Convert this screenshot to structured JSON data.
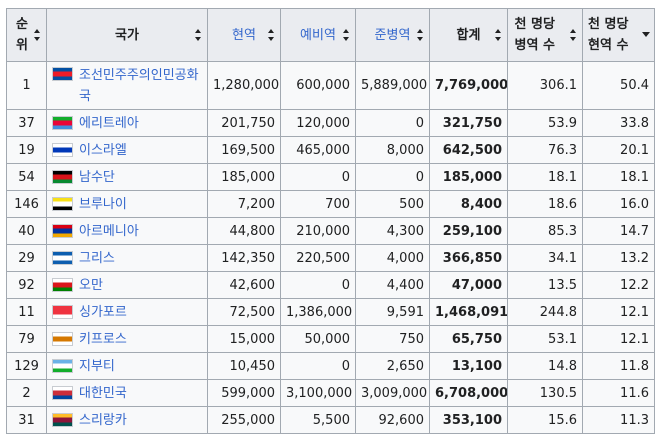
{
  "headers": [
    {
      "label": "순위",
      "link": false,
      "sort": "both"
    },
    {
      "label": "국가",
      "link": false,
      "sort": "both"
    },
    {
      "label": "현역",
      "link": true,
      "sort": "both"
    },
    {
      "label": "예비역",
      "link": true,
      "sort": "both"
    },
    {
      "label": "준병역",
      "link": true,
      "sort": "both"
    },
    {
      "label": "합계",
      "link": false,
      "sort": "both"
    },
    {
      "label": "천 명당 병역 수",
      "link": false,
      "sort": "both"
    },
    {
      "label": "천 명당 현역 수",
      "link": false,
      "sort": "down"
    }
  ],
  "rows": [
    {
      "rank": "1",
      "country": "조선민주주의인민공화국",
      "flag_colors": [
        "#024fa2",
        "#ed1c27",
        "#024fa2"
      ],
      "active": "1,280,000",
      "reserve": "600,000",
      "paramilitary": "5,889,000",
      "total": "7,769,000",
      "mil_per_1000": "306.1",
      "active_per_1000": "50.4"
    },
    {
      "rank": "37",
      "country": "에리트레아",
      "flag_colors": [
        "#12ad2b",
        "#ea0437",
        "#418fde"
      ],
      "active": "201,750",
      "reserve": "120,000",
      "paramilitary": "0",
      "total": "321,750",
      "mil_per_1000": "53.9",
      "active_per_1000": "33.8"
    },
    {
      "rank": "19",
      "country": "이스라엘",
      "flag_colors": [
        "#ffffff",
        "#0038b8",
        "#ffffff"
      ],
      "active": "169,500",
      "reserve": "465,000",
      "paramilitary": "8,000",
      "total": "642,500",
      "mil_per_1000": "76.3",
      "active_per_1000": "20.1"
    },
    {
      "rank": "54",
      "country": "남수단",
      "flag_colors": [
        "#000000",
        "#da121a",
        "#078930"
      ],
      "active": "185,000",
      "reserve": "0",
      "paramilitary": "0",
      "total": "185,000",
      "mil_per_1000": "18.1",
      "active_per_1000": "18.1"
    },
    {
      "rank": "146",
      "country": "브루나이",
      "flag_colors": [
        "#f7e017",
        "#ffffff",
        "#000000"
      ],
      "active": "7,200",
      "reserve": "700",
      "paramilitary": "500",
      "total": "8,400",
      "mil_per_1000": "18.6",
      "active_per_1000": "16.0"
    },
    {
      "rank": "40",
      "country": "아르메니아",
      "flag_colors": [
        "#d90012",
        "#0033a0",
        "#f2a800"
      ],
      "active": "44,800",
      "reserve": "210,000",
      "paramilitary": "4,300",
      "total": "259,100",
      "mil_per_1000": "85.3",
      "active_per_1000": "14.7"
    },
    {
      "rank": "29",
      "country": "그리스",
      "flag_colors": [
        "#0d5eaf",
        "#ffffff",
        "#0d5eaf"
      ],
      "active": "142,350",
      "reserve": "220,500",
      "paramilitary": "4,000",
      "total": "366,850",
      "mil_per_1000": "34.1",
      "active_per_1000": "13.2"
    },
    {
      "rank": "92",
      "country": "오만",
      "flag_colors": [
        "#ffffff",
        "#db161b",
        "#008000"
      ],
      "active": "42,600",
      "reserve": "0",
      "paramilitary": "4,400",
      "total": "47,000",
      "mil_per_1000": "13.5",
      "active_per_1000": "12.2"
    },
    {
      "rank": "11",
      "country": "싱가포르",
      "flag_colors": [
        "#ef3340",
        "#ef3340",
        "#ffffff"
      ],
      "active": "72,500",
      "reserve": "1,386,000",
      "paramilitary": "9,591",
      "total": "1,468,091",
      "mil_per_1000": "244.8",
      "active_per_1000": "12.1"
    },
    {
      "rank": "79",
      "country": "키프로스",
      "flag_colors": [
        "#ffffff",
        "#d57800",
        "#ffffff"
      ],
      "active": "15,000",
      "reserve": "50,000",
      "paramilitary": "750",
      "total": "65,750",
      "mil_per_1000": "53.1",
      "active_per_1000": "12.1"
    },
    {
      "rank": "129",
      "country": "지부티",
      "flag_colors": [
        "#6ab2e7",
        "#ffffff",
        "#12ad2b"
      ],
      "active": "10,450",
      "reserve": "0",
      "paramilitary": "2,650",
      "total": "13,100",
      "mil_per_1000": "14.8",
      "active_per_1000": "11.8"
    },
    {
      "rank": "2",
      "country": "대한민국",
      "flag_colors": [
        "#ffffff",
        "#cd2e3a",
        "#0047a0"
      ],
      "active": "599,000",
      "reserve": "3,100,000",
      "paramilitary": "3,009,000",
      "total": "6,708,000",
      "mil_per_1000": "130.5",
      "active_per_1000": "11.6"
    },
    {
      "rank": "31",
      "country": "스리랑카",
      "flag_colors": [
        "#ffbe29",
        "#8d153a",
        "#00534e"
      ],
      "active": "255,000",
      "reserve": "5,500",
      "paramilitary": "92,600",
      "total": "353,100",
      "mil_per_1000": "15.6",
      "active_per_1000": "11.3"
    }
  ]
}
